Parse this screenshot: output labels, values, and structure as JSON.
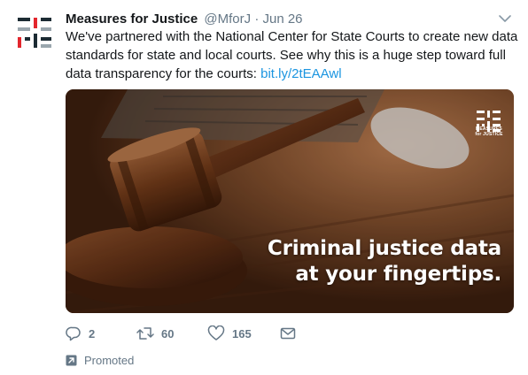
{
  "tweet": {
    "author_name": "Measures for Justice",
    "handle": "@MforJ",
    "separator": "·",
    "time": "Jun 26",
    "text_before_link": "We've partnered with the National Center for State Courts to create new data standards for state and local courts. See why this is a huge step toward full data transparency for the courts: ",
    "link_text": "bit.ly/2tEAAwl",
    "avatar_icon": "measures-for-justice-logo",
    "menu_icon": "chevron-down-icon"
  },
  "media": {
    "overlay_line1": "Criminal justice data",
    "overlay_line2": "at your fingertips.",
    "logo_line1": "MEASURES",
    "logo_line2": "for JUSTICE"
  },
  "actions": {
    "reply_count": "2",
    "retweet_count": "60",
    "like_count": "165",
    "reply_icon": "reply-icon",
    "retweet_icon": "retweet-icon",
    "like_icon": "heart-icon",
    "dm_icon": "envelope-icon"
  },
  "promoted": {
    "label": "Promoted",
    "icon": "promoted-arrow-icon"
  },
  "colors": {
    "text": "#14171a",
    "muted": "#657786",
    "link": "#1b95e0",
    "logo_red": "#e3262d",
    "logo_dark": "#1c2b33",
    "logo_gray": "#9aa6ad"
  }
}
